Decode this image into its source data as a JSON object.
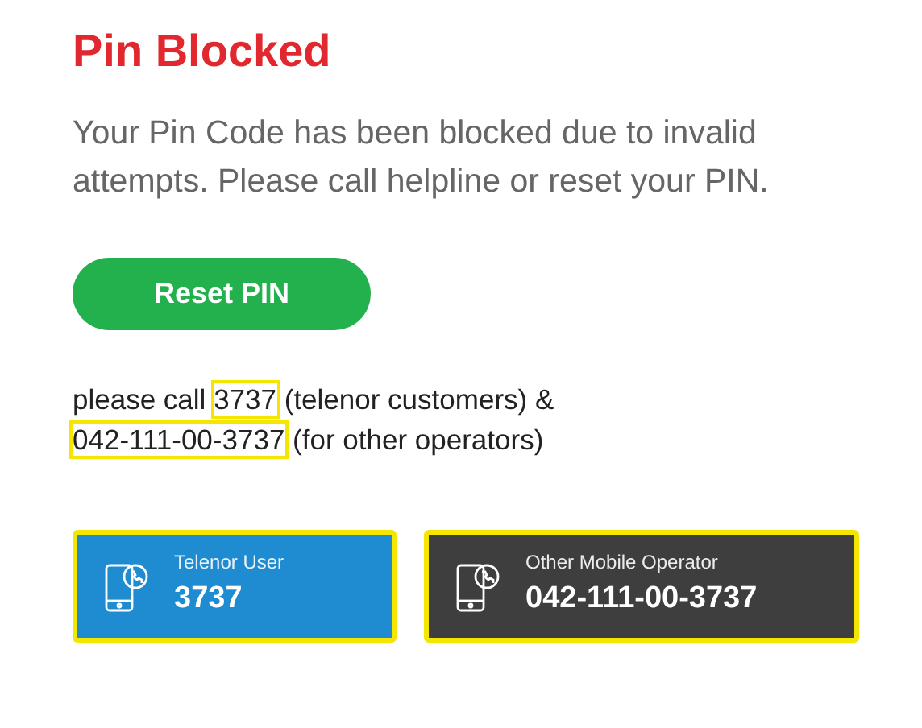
{
  "title": "Pin Blocked",
  "message": "Your Pin Code has been blocked due to invalid attempts. Please call helpline or reset your PIN.",
  "reset_button": "Reset PIN",
  "call_note": [
    {
      "text": "please call ",
      "highlighted": false
    },
    {
      "text": "3737",
      "highlighted": true
    },
    {
      "text": " (telenor customers) & ",
      "highlighted": false
    },
    {
      "text": "042-111-00-3737",
      "highlighted": true
    },
    {
      "text": " (for other operators)",
      "highlighted": false
    }
  ],
  "call_cards": [
    {
      "label": "Telenor User",
      "number": "3737",
      "kind": "telenor",
      "highlighted": true
    },
    {
      "label": "Other Mobile Operator",
      "number": "042-111-00-3737",
      "kind": "other",
      "highlighted": true
    }
  ]
}
